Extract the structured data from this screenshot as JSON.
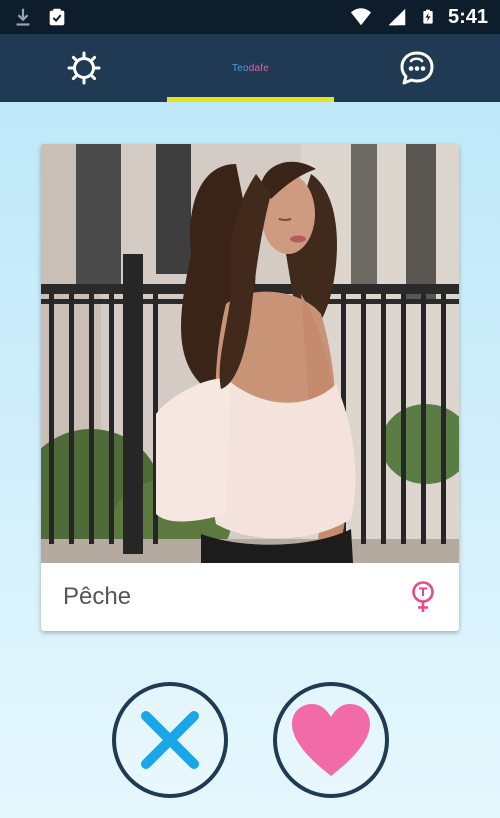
{
  "status_bar": {
    "time": "5:41",
    "icons": [
      "download-icon",
      "clipboard-check-icon",
      "wifi-icon",
      "cell-signal-icon",
      "battery-charging-icon"
    ]
  },
  "app_bar": {
    "logo": {
      "part1": "Teo",
      "part2": "dafe"
    },
    "tabs": [
      "settings-icon",
      "logo",
      "chat-icon"
    ],
    "active_tab": "logo",
    "indicator_color": "#e8e41b",
    "background_color": "#1f3a52"
  },
  "card": {
    "name": "Pêche",
    "gender_icon": "female-symbol-icon",
    "gender_icon_color": "#e74a8b",
    "photo": "profile-photo"
  },
  "actions": {
    "dislike_icon": "x-icon",
    "dislike_color": "#1aa7e8",
    "like_icon": "heart-icon",
    "like_color": "#f36aa8"
  }
}
